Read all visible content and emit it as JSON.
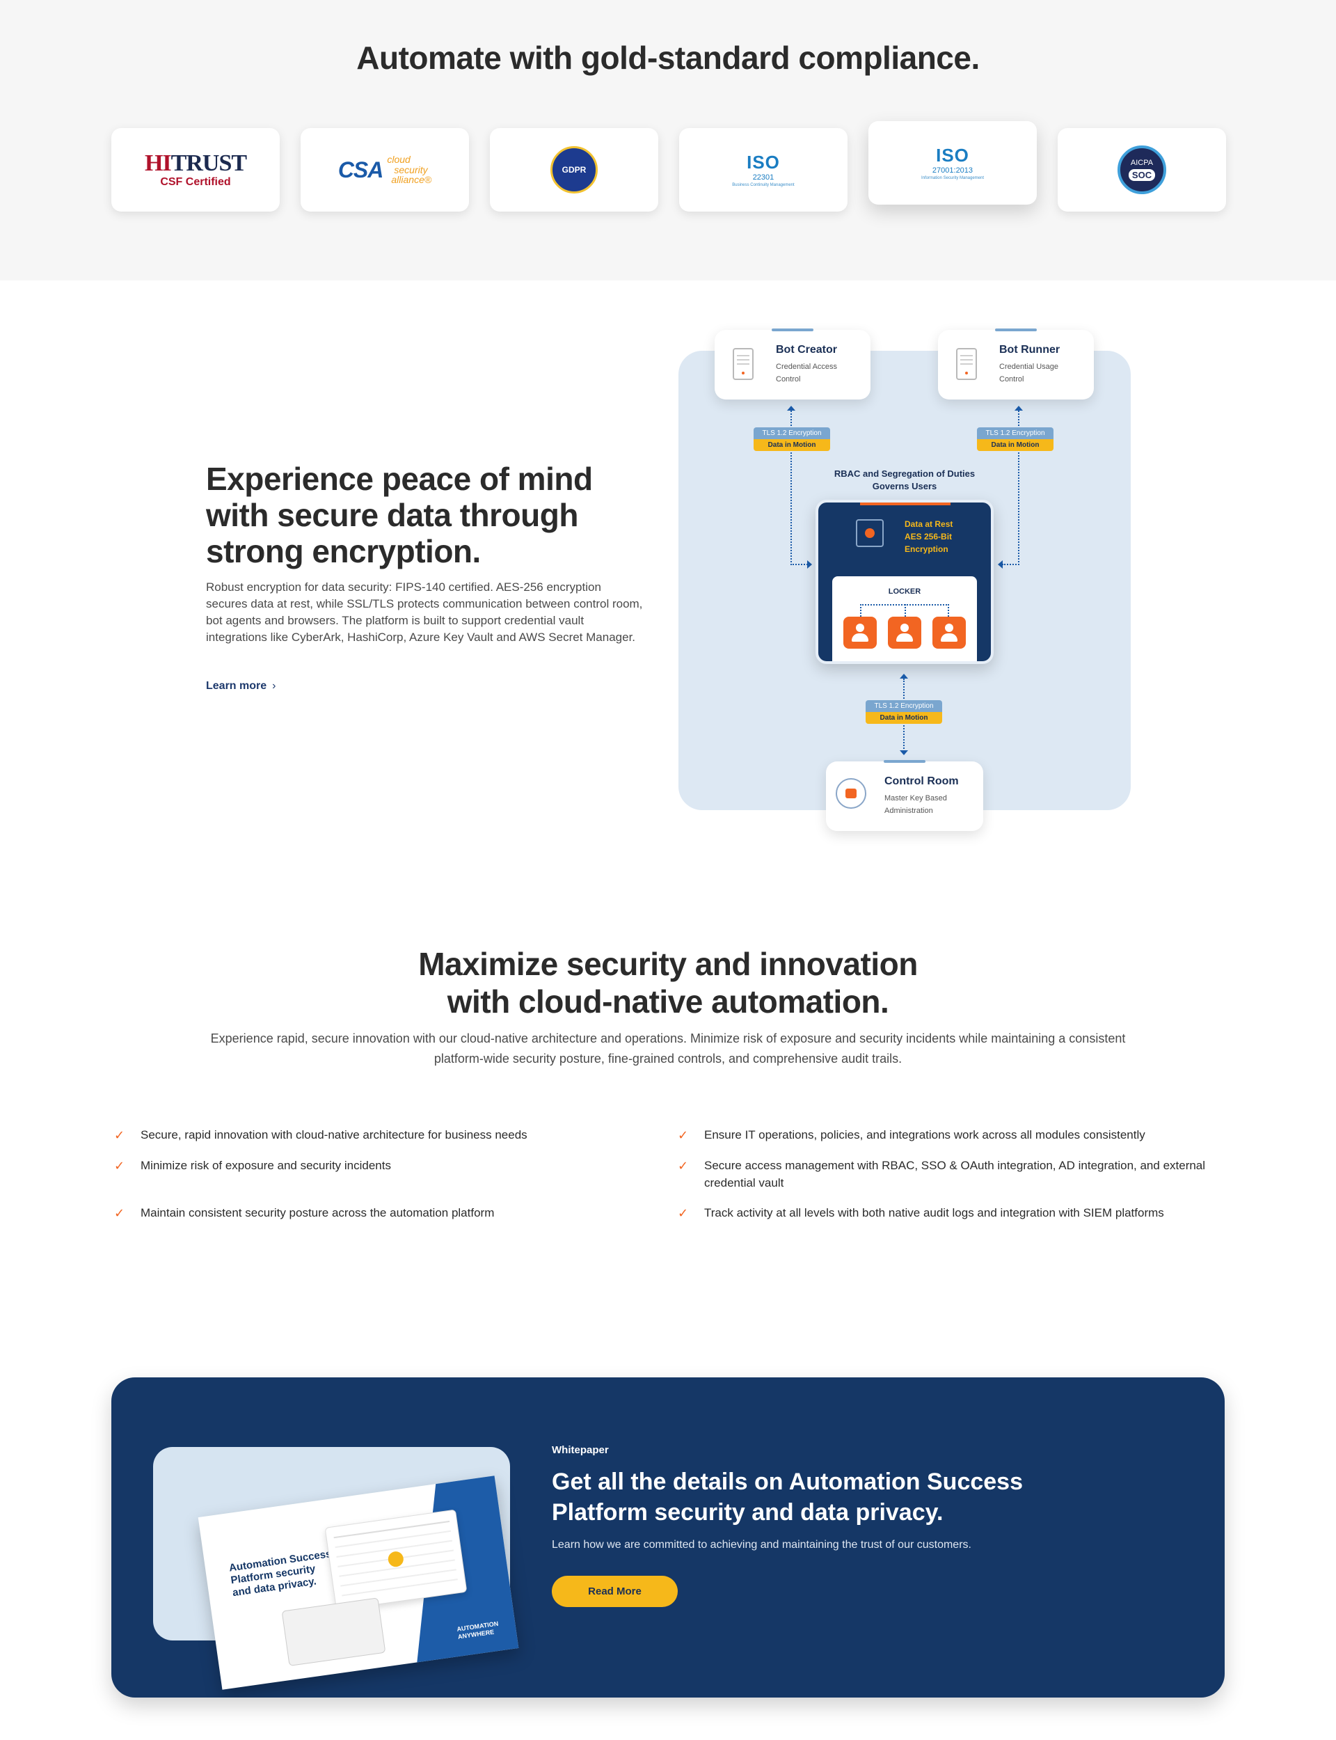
{
  "compliance": {
    "title": "Automate with gold-standard compliance.",
    "badges": {
      "hitrust": {
        "big_red": "HI",
        "big_blue": "TRUST",
        "sub": "CSF Certified"
      },
      "csa": {
        "mark": "CSA",
        "line1": "cloud",
        "line2": "security",
        "line3": "alliance®"
      },
      "gdpr": {
        "label": "GDPR"
      },
      "iso22301": {
        "word": "ISO",
        "number": "22301",
        "desc": "Business Continuity Management"
      },
      "iso27001": {
        "word": "ISO",
        "number": "27001:2013",
        "desc": "Information Security Management"
      },
      "aicpa": {
        "top": "AICPA",
        "badge": "SOC"
      }
    }
  },
  "encryption": {
    "title": "Experience peace of mind with secure data through strong encryption.",
    "body": "Robust encryption for data security: FIPS-140 certified. AES-256 encryption secures data at rest, while SSL/TLS protects communication between control room, bot agents and browsers. The platform is built to support credential vault integrations like CyberArk, HashiCorp, Azure Key Vault and AWS Secret Manager.",
    "learn_more": "Learn more",
    "diagram": {
      "bot_creator": {
        "title": "Bot Creator",
        "sub": "Credential Access Control"
      },
      "bot_runner": {
        "title": "Bot Runner",
        "sub": "Credential Usage Control"
      },
      "tls_label": "TLS 1.2 Encryption",
      "motion_label": "Data in Motion",
      "rbac": "RBAC and Segregation of Duties Governs Users",
      "at_rest_1": "Data at Rest",
      "at_rest_2": "AES 256-Bit",
      "at_rest_3": "Encryption",
      "locker": "LOCKER",
      "control_room": {
        "title": "Control Room",
        "sub": "Master Key Based Administration"
      }
    }
  },
  "maximize": {
    "title_line1": "Maximize security and innovation",
    "title_line2": "with cloud-native automation.",
    "body": "Experience rapid, secure innovation with our cloud-native architecture and operations. Minimize risk of exposure and security incidents while maintaining a consistent platform-wide security posture, fine-grained controls, and comprehensive audit trails.",
    "features_left": [
      "Secure, rapid innovation with cloud-native architecture for business needs",
      "Minimize risk of exposure and security incidents",
      "Maintain consistent security posture across the automation platform"
    ],
    "features_right": [
      "Ensure IT operations, policies, and integrations work across all modules consistently",
      "Secure access management with RBAC, SSO & OAuth integration, AD integration, and external credential vault",
      "Track activity at all levels with both native audit logs and integration with SIEM platforms"
    ]
  },
  "whitepaper": {
    "label": "Whitepaper",
    "title": "Get all the details on Automation Success Platform security and data privacy.",
    "body": "Learn how we are committed to achieving and maintaining the trust of our customers.",
    "button": "Read More",
    "card_title": "Automation Success Platform security and data privacy.",
    "card_brand_1": "AUTOMATION",
    "card_brand_2": "ANYWHERE"
  },
  "colors": {
    "navy": "#153766",
    "accent_orange": "#f26522",
    "accent_yellow": "#f6b81a",
    "diagram_bg": "#dde8f3",
    "section_grey": "#f6f6f6"
  },
  "icons": [
    "server-icon",
    "safe-icon",
    "user-icon",
    "lock-icon",
    "check-icon",
    "chevron-right-icon"
  ]
}
